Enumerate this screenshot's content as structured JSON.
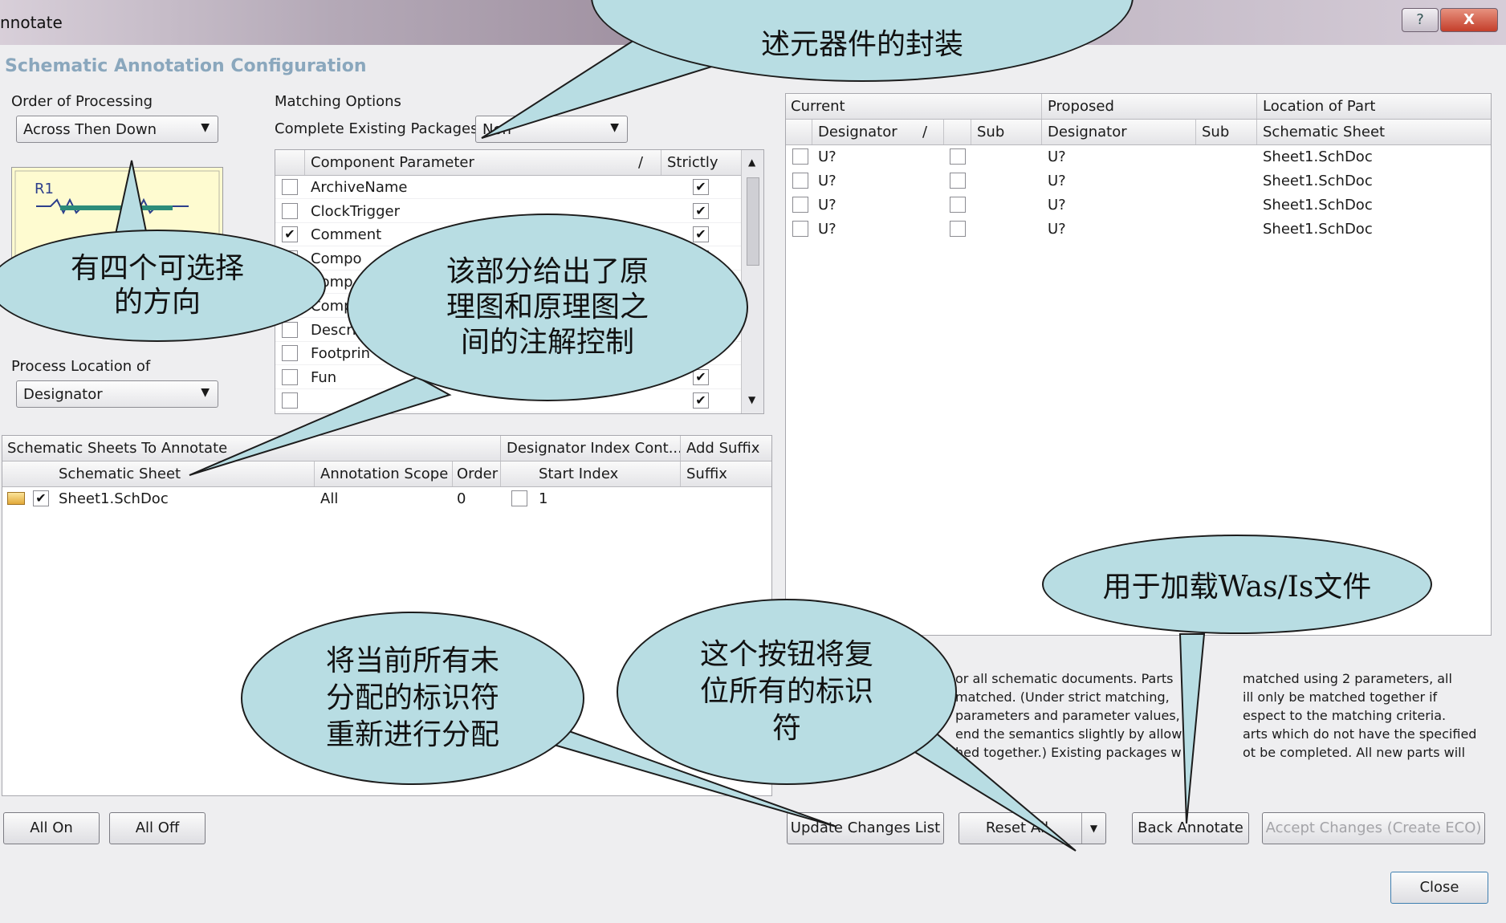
{
  "window": {
    "title": "nnotate",
    "help_glyph": "?",
    "close_glyph": "X"
  },
  "heading": "Schematic Annotation Configuration",
  "processing": {
    "label": "Order of Processing",
    "value": "Across Then Down",
    "preview_ref": "R1",
    "location_label": "Process Location of",
    "location_value": "Designator"
  },
  "matching": {
    "label": "Matching Options",
    "complete_label": "Complete Existing Packages",
    "complete_value": "Non",
    "col_param": "Component Parameter",
    "col_strict": "Strictly",
    "rows": [
      {
        "checked": false,
        "name": "ArchiveName",
        "strict": true
      },
      {
        "checked": false,
        "name": "ClockTrigger",
        "strict": true
      },
      {
        "checked": true,
        "name": "Comment",
        "strict": true
      },
      {
        "checked": false,
        "name": "Compo",
        "strict": false
      },
      {
        "checked": false,
        "name": "Comp",
        "strict": false
      },
      {
        "checked": false,
        "name": "Comp",
        "strict": false
      },
      {
        "checked": false,
        "name": "Descrip",
        "strict": false
      },
      {
        "checked": false,
        "name": "Footprin",
        "strict": false
      },
      {
        "checked": false,
        "name": "Fun",
        "strict": true
      },
      {
        "checked": false,
        "name": "",
        "strict": true
      }
    ]
  },
  "sheets": {
    "group1": "Schematic Sheets To Annotate",
    "group2": "Designator Index Cont...",
    "group3": "Add Suffix",
    "cols": {
      "sheet": "Schematic Sheet",
      "scope": "Annotation Scope",
      "order": "Order",
      "start": "Start Index",
      "suffix": "Suffix"
    },
    "rows": [
      {
        "checked": true,
        "sheet": "Sheet1.SchDoc",
        "scope": "All",
        "order": "0",
        "start_checked": false,
        "start": "1"
      }
    ]
  },
  "changes": {
    "group_current": "Current",
    "group_proposed": "Proposed",
    "group_location": "Location of Part",
    "col_designator": "Designator",
    "col_sort": "/",
    "col_sub": "Sub",
    "col_sheet": "Schematic Sheet",
    "rows": [
      {
        "current": "U?",
        "proposed": "U?",
        "sheet": "Sheet1.SchDoc"
      },
      {
        "current": "U?",
        "proposed": "U?",
        "sheet": "Sheet1.SchDoc"
      },
      {
        "current": "U?",
        "proposed": "U?",
        "sheet": "Sheet1.SchDoc"
      },
      {
        "current": "U?",
        "proposed": "U?",
        "sheet": "Sheet1.SchDoc"
      }
    ]
  },
  "description": [
    "or all schematic documents. Parts",
    "matched. (Under strict matching,",
    "parameters and parameter values,",
    "end the semantics slightly by allow",
    "hed together.) Existing packages w"
  ],
  "description_right": [
    "matched using 2 parameters, all",
    "ill only be matched together if",
    "espect to the matching criteria.",
    "arts which do not have the specified",
    "ot be completed. All new parts will"
  ],
  "buttons": {
    "all_on": "All On",
    "all_off": "All Off",
    "update": "Update Changes List",
    "reset_all": "Reset All",
    "back_annotate": "Back Annotate",
    "accept": "Accept Changes (Create ECO)",
    "close": "Close"
  },
  "callouts": {
    "top": "述元器件的封装",
    "directions": [
      "有四个可选择",
      "的方向"
    ],
    "control": [
      "该部分给出了原",
      "理图和原理图之",
      "间的注解控制"
    ],
    "wasis": "用于加载Was/Is文件",
    "reassign": [
      "将当前所有未",
      "分配的标识符",
      "重新进行分配"
    ],
    "reset": [
      "这个按钮将复",
      "位所有的标识",
      "符"
    ]
  },
  "colors": {
    "bubble": "#b8dde3",
    "heading": "#8aa7bd",
    "close_button": "#c43e2a"
  }
}
